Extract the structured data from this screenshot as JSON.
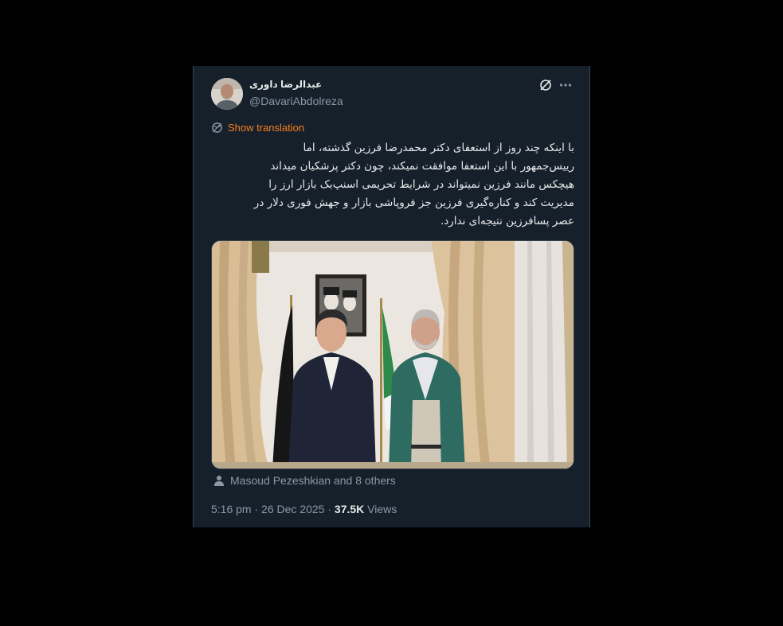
{
  "tweet": {
    "author": {
      "display_name": "عبدالرضا داوری",
      "handle": "@DavariAbdolreza",
      "avatar_icon": "avatar-photo"
    },
    "header_icons": [
      "grok-icon",
      "more-options-icon"
    ],
    "translation": {
      "icon": "translate-icon",
      "label": "Show translation",
      "color": "#f97f1c"
    },
    "text_lines": [
      "با اینکه چند روز از استعفای دکتر محمدرضا فرزین گذشته، اما",
      "رییس‌جمهور با این استعفا موافقت نمیکند، چون دکتر پزشکیان میداند",
      "هیچکس مانند فرزین نمیتواند در شرایط تحریمی اسنپ‌بک بازار ارز را",
      "مدیریت کند و کناره‌گیری فرزین جز فروپاشی بازار و جهش فوری دلار در",
      "عصر پسافرزین نتیجه‌ای ندارد."
    ],
    "media": {
      "description_icon": "photo-two-men-office"
    },
    "tagged": {
      "icon": "person-icon",
      "label": "Masoud Pezeshkian and 8 others"
    },
    "meta": {
      "time": "5:16 pm",
      "separator": "·",
      "date": "26 Dec 2025",
      "views_count": "37.5K",
      "views_label": "Views"
    }
  },
  "colors": {
    "background": "#000000",
    "card": "#15202b",
    "text_primary": "#e7e9ea",
    "text_secondary": "#8b98a5",
    "accent": "#f97f1c"
  }
}
